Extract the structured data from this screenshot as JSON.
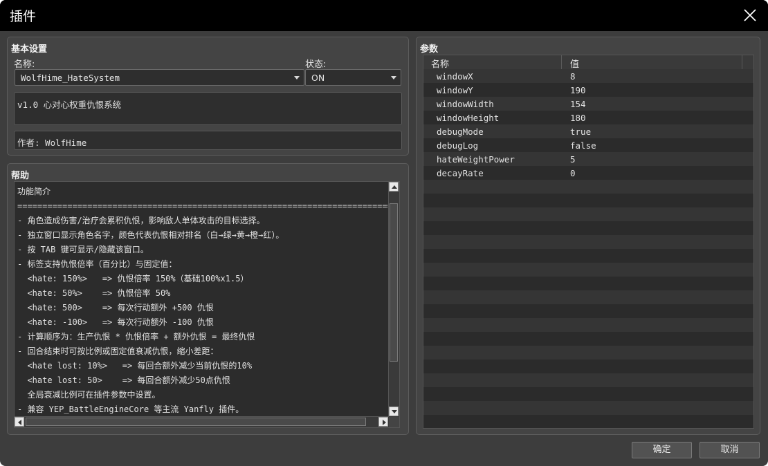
{
  "window": {
    "title": "插件"
  },
  "basic": {
    "group_title": "基本设置",
    "name_label": "名称:",
    "name_value": "WolfHime_HateSystem",
    "status_label": "状态:",
    "status_value": "ON",
    "description": "v1.0 心对心权重仇恨系统",
    "author": "作者: WolfHime"
  },
  "help": {
    "group_title": "帮助",
    "lines": [
      "功能简介",
      "=============================================================================",
      "- 角色造成伤害/治疗会累积仇恨，影响敌人单体攻击的目标选择。",
      "- 独立窗口显示角色名字，颜色代表仇恨相对排名（白→绿→黄→橙→红）。",
      "- 按 TAB 键可显示/隐藏该窗口。",
      "- 标签支持仇恨倍率（百分比）与固定值：",
      "  <hate: 150%>   => 仇恨倍率 150%（基础100%x1.5）",
      "  <hate: 50%>    => 仇恨倍率 50%",
      "  <hate: 500>    => 每次行动额外 +500 仇恨",
      "  <hate: -100>   => 每次行动额外 -100 仇恨",
      "- 计算顺序为：生产仇恨 * 仇恨倍率 + 额外仇恨 = 最终仇恨",
      "- 回合结束时可按比例或固定值衰减仇恨，缩小差距：",
      "  <hate lost: 10%>   => 每回合额外减少当前仇恨的10%",
      "  <hate lost: 50>    => 每回合额外减少50点仇恨",
      "  全局衰减比例可在插件参数中设置。",
      "- 兼容 YEP_BattleEngineCore 等主流 Yanfly 插件。"
    ]
  },
  "params": {
    "group_title": "参数",
    "col_name": "名称",
    "col_value": "值",
    "rows": [
      {
        "name": "windowX",
        "value": "8"
      },
      {
        "name": "windowY",
        "value": "190"
      },
      {
        "name": "windowWidth",
        "value": "154"
      },
      {
        "name": "windowHeight",
        "value": "180"
      },
      {
        "name": "debugMode",
        "value": "true"
      },
      {
        "name": "debugLog",
        "value": "false"
      },
      {
        "name": "hateWeightPower",
        "value": "5"
      },
      {
        "name": "decayRate",
        "value": "0"
      }
    ]
  },
  "footer": {
    "ok_label": "确定",
    "cancel_label": "取消"
  },
  "icons": {
    "close": "close-icon",
    "dropdown": "chevron-down-icon"
  }
}
